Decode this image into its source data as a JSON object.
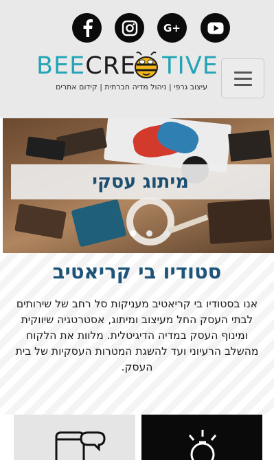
{
  "header": {
    "social": [
      {
        "name": "facebook",
        "icon": "facebook-icon"
      },
      {
        "name": "instagram",
        "icon": "instagram-icon"
      },
      {
        "name": "google-plus",
        "icon": "google-plus-icon",
        "label": "G+"
      },
      {
        "name": "youtube",
        "icon": "youtube-icon"
      }
    ],
    "logo": {
      "part1": "BEE",
      "part2": "CRE",
      "part3": "TIVE",
      "tagline": "עיצוב גרפי | ניהול מדיה חברתית | קידום אתרים"
    },
    "menu_icon": "hamburger-icon"
  },
  "hero": {
    "caption": "מיתוג עסקי",
    "slide_count": 3,
    "active_slide": 1
  },
  "about": {
    "title": "סטודיו בי קריאטיב",
    "body": "אנו בסטודיו בי קריאטיב מעניקות סל רחב של שירותים לבתי העסק החל מעיצוב ומיתוג, אסטרטגיה שיווקית ומינוף העסק במדיה הדיגיטלית. מלוות את הלקוח מהשלב הרעיוני ועד להשגת המטרות העסקיות של בית העסק."
  },
  "services": [
    {
      "icon": "phone-chat-icon"
    },
    {
      "icon": "lightbulb-icon"
    }
  ],
  "colors": {
    "header_bg": "#e9e9e9",
    "brand_teal": "#1a9fb0",
    "title_blue": "#1e5478",
    "social_bg": "#0b0b0b"
  }
}
